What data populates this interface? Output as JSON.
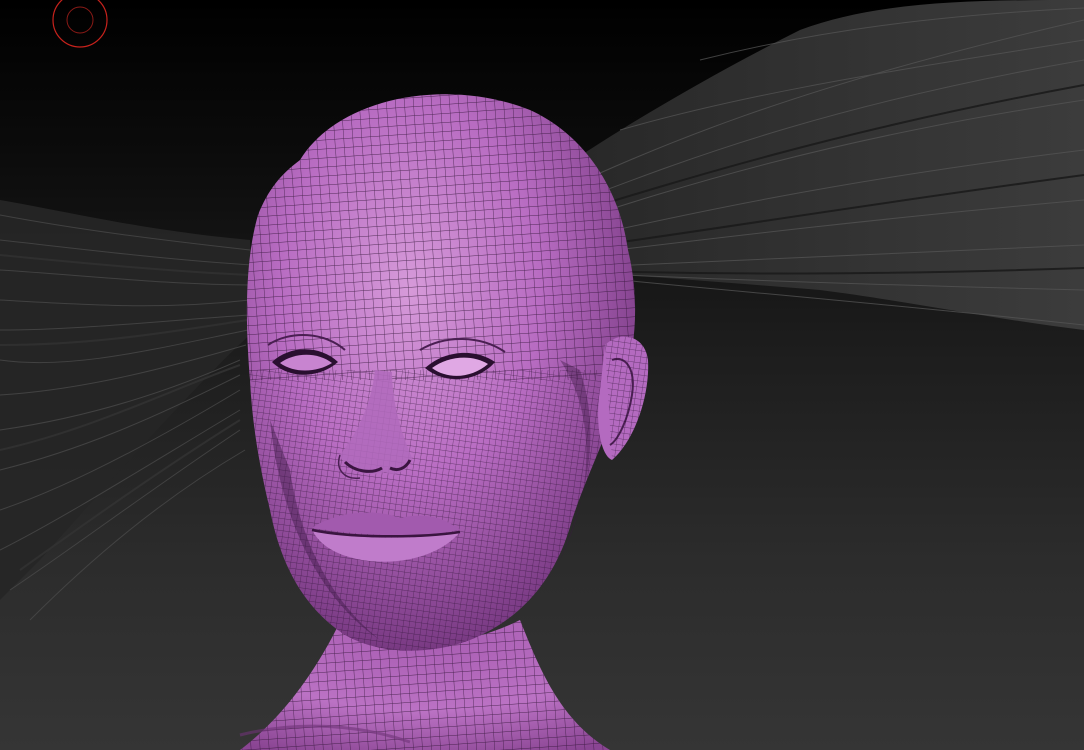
{
  "viewport": {
    "background_top": "#000000",
    "background_bottom": "#353535"
  },
  "model": {
    "skin_color": "#b86cc2",
    "skin_highlight": "#d59ad9",
    "skin_shadow": "#4a1f52",
    "wire_color": "#2a1030",
    "hair_color": "#4a4a4a"
  },
  "cursor": {
    "icon": "brush-cursor-icon",
    "color": "#c8221c"
  }
}
